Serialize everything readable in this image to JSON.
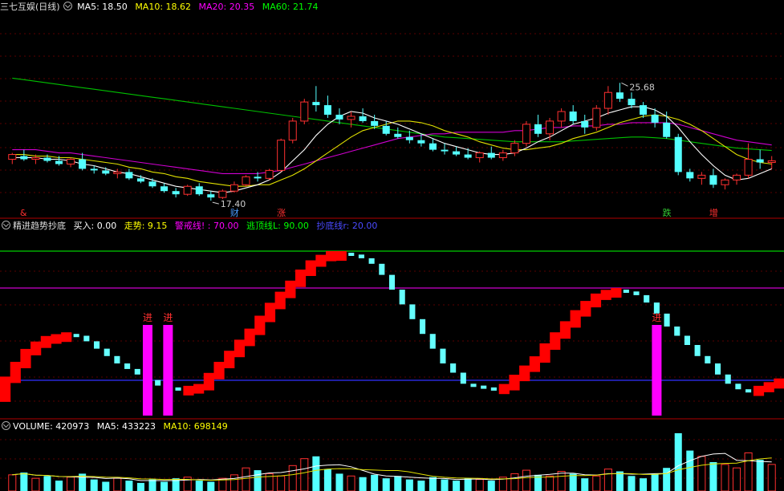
{
  "main": {
    "title": "三七互娱(日线)",
    "ma": [
      {
        "label": "MA5: 18.50",
        "color": "#ffffff"
      },
      {
        "label": "MA10: 18.62",
        "color": "#ffff00"
      },
      {
        "label": "MA20: 20.35",
        "color": "#ff00ff"
      },
      {
        "label": "MA60: 21.74",
        "color": "#00ff00"
      }
    ],
    "high_label": "25.68",
    "low_label": "17.40",
    "event_markers": [
      {
        "text": "&",
        "color": "#ff3030",
        "date_index": 1
      },
      {
        "text": "财",
        "color": "#4a9cff",
        "date_index": 19
      },
      {
        "text": "涨",
        "color": "#ff3030",
        "date_index": 23
      },
      {
        "text": "跌",
        "color": "#33cc33",
        "date_index": 56
      },
      {
        "text": "增",
        "color": "#ff3030",
        "date_index": 60
      }
    ],
    "candles": [
      [
        17.2,
        17.6,
        16.9,
        17.5
      ],
      [
        17.4,
        17.8,
        17.1,
        17.2
      ],
      [
        17.2,
        17.5,
        16.9,
        17.3
      ],
      [
        17.3,
        17.5,
        17.0,
        17.1
      ],
      [
        17.1,
        17.4,
        16.8,
        16.9
      ],
      [
        16.9,
        17.3,
        16.7,
        17.2
      ],
      [
        17.2,
        17.6,
        16.5,
        16.6
      ],
      [
        16.6,
        16.8,
        16.3,
        16.5
      ],
      [
        16.5,
        16.7,
        16.2,
        16.3
      ],
      [
        16.3,
        16.6,
        16.0,
        16.4
      ],
      [
        16.4,
        16.6,
        15.9,
        16.0
      ],
      [
        16.0,
        16.2,
        15.7,
        15.8
      ],
      [
        15.8,
        16.0,
        15.4,
        15.5
      ],
      [
        15.5,
        15.7,
        15.1,
        15.2
      ],
      [
        15.2,
        15.4,
        14.8,
        15.0
      ],
      [
        15.0,
        15.6,
        14.9,
        15.5
      ],
      [
        15.5,
        15.7,
        14.9,
        15.0
      ],
      [
        15.0,
        15.2,
        14.6,
        14.8
      ],
      [
        14.8,
        15.3,
        14.7,
        15.2
      ],
      [
        15.2,
        15.8,
        15.1,
        15.6
      ],
      [
        15.6,
        16.2,
        15.5,
        16.1
      ],
      [
        16.1,
        16.4,
        15.8,
        16.0
      ],
      [
        16.0,
        16.6,
        15.9,
        16.5
      ],
      [
        16.5,
        18.5,
        16.4,
        18.4
      ],
      [
        18.4,
        19.8,
        18.2,
        19.6
      ],
      [
        19.6,
        21.0,
        19.4,
        20.8
      ],
      [
        20.8,
        21.8,
        20.2,
        20.6
      ],
      [
        20.6,
        21.2,
        19.8,
        20.0
      ],
      [
        20.0,
        20.4,
        19.4,
        19.7
      ],
      [
        19.7,
        20.2,
        19.2,
        19.9
      ],
      [
        19.9,
        20.4,
        19.5,
        19.6
      ],
      [
        19.6,
        20.0,
        19.1,
        19.3
      ],
      [
        19.3,
        19.6,
        18.7,
        18.8
      ],
      [
        18.8,
        19.2,
        18.5,
        18.6
      ],
      [
        18.6,
        19.0,
        18.2,
        18.4
      ],
      [
        18.4,
        18.8,
        18.0,
        18.2
      ],
      [
        18.2,
        18.5,
        17.7,
        17.8
      ],
      [
        17.8,
        18.2,
        17.5,
        17.7
      ],
      [
        17.7,
        18.0,
        17.4,
        17.5
      ],
      [
        17.5,
        17.9,
        17.2,
        17.3
      ],
      [
        17.3,
        17.7,
        17.0,
        17.6
      ],
      [
        17.6,
        18.0,
        17.2,
        17.3
      ],
      [
        17.3,
        17.8,
        17.1,
        17.6
      ],
      [
        17.6,
        18.4,
        17.4,
        18.2
      ],
      [
        18.2,
        19.6,
        18.0,
        19.4
      ],
      [
        19.4,
        20.0,
        18.6,
        18.8
      ],
      [
        18.8,
        19.8,
        18.4,
        19.6
      ],
      [
        19.6,
        20.4,
        19.2,
        20.2
      ],
      [
        20.2,
        20.6,
        19.4,
        19.6
      ],
      [
        19.6,
        20.0,
        18.8,
        19.2
      ],
      [
        19.2,
        20.6,
        19.0,
        20.4
      ],
      [
        20.4,
        21.8,
        20.0,
        21.4
      ],
      [
        21.4,
        22.0,
        20.8,
        21.0
      ],
      [
        21.0,
        21.4,
        20.4,
        20.6
      ],
      [
        20.6,
        20.8,
        19.8,
        20.0
      ],
      [
        20.0,
        20.4,
        19.2,
        19.5
      ],
      [
        19.5,
        20.2,
        18.5,
        18.6
      ],
      [
        18.6,
        18.8,
        16.2,
        16.4
      ],
      [
        16.4,
        16.6,
        15.8,
        16.0
      ],
      [
        16.0,
        16.4,
        15.6,
        16.2
      ],
      [
        16.2,
        16.6,
        15.4,
        15.6
      ],
      [
        15.6,
        16.0,
        15.3,
        15.9
      ],
      [
        15.9,
        16.3,
        15.6,
        16.2
      ],
      [
        16.2,
        18.2,
        16.0,
        17.2
      ],
      [
        17.2,
        17.8,
        16.6,
        17.0
      ],
      [
        17.0,
        17.4,
        16.6,
        17.1
      ]
    ],
    "ma5": [
      17.3,
      17.3,
      17.3,
      17.2,
      17.2,
      17.1,
      16.9,
      16.8,
      16.6,
      16.4,
      16.3,
      16.1,
      15.9,
      15.7,
      15.5,
      15.4,
      15.3,
      15.2,
      15.1,
      15.2,
      15.4,
      15.6,
      15.9,
      16.4,
      17.1,
      17.8,
      18.7,
      19.4,
      19.9,
      20.2,
      20.1,
      19.8,
      19.6,
      19.4,
      19.1,
      18.8,
      18.5,
      18.2,
      18.0,
      17.8,
      17.6,
      17.5,
      17.5,
      17.6,
      17.9,
      18.3,
      18.6,
      19.0,
      19.4,
      19.6,
      19.8,
      20.1,
      20.3,
      20.5,
      20.5,
      20.3,
      19.9,
      19.2,
      18.3,
      17.5,
      16.8,
      16.2,
      15.9,
      16.0,
      16.3,
      16.6
    ],
    "ma10": [
      17.5,
      17.5,
      17.4,
      17.4,
      17.3,
      17.3,
      17.2,
      17.1,
      17.0,
      16.9,
      16.7,
      16.6,
      16.4,
      16.3,
      16.1,
      16.0,
      15.8,
      15.7,
      15.6,
      15.5,
      15.5,
      15.6,
      15.6,
      15.9,
      16.2,
      16.6,
      17.1,
      17.6,
      18.1,
      18.6,
      19.0,
      19.2,
      19.4,
      19.6,
      19.6,
      19.5,
      19.3,
      19.0,
      18.8,
      18.6,
      18.3,
      18.1,
      17.9,
      17.8,
      17.8,
      17.9,
      18.0,
      18.2,
      18.5,
      18.7,
      18.9,
      19.2,
      19.5,
      19.7,
      19.9,
      20.0,
      19.9,
      19.7,
      19.4,
      19.0,
      18.5,
      18.0,
      17.5,
      17.2,
      17.0,
      16.9
    ],
    "ma20": [
      17.8,
      17.8,
      17.8,
      17.7,
      17.6,
      17.6,
      17.5,
      17.4,
      17.3,
      17.2,
      17.1,
      17.0,
      16.9,
      16.8,
      16.7,
      16.6,
      16.5,
      16.4,
      16.3,
      16.3,
      16.3,
      16.3,
      16.4,
      16.5,
      16.7,
      16.9,
      17.1,
      17.3,
      17.5,
      17.7,
      17.9,
      18.1,
      18.3,
      18.5,
      18.6,
      18.7,
      18.8,
      18.8,
      18.9,
      18.9,
      18.9,
      18.9,
      18.9,
      19.0,
      19.0,
      19.1,
      19.2,
      19.2,
      19.3,
      19.3,
      19.3,
      19.4,
      19.4,
      19.5,
      19.5,
      19.5,
      19.5,
      19.4,
      19.2,
      19.0,
      18.8,
      18.6,
      18.4,
      18.3,
      18.2,
      18.1
    ],
    "ma60": [
      22.3,
      22.2,
      22.1,
      22.0,
      21.9,
      21.8,
      21.7,
      21.6,
      21.5,
      21.4,
      21.3,
      21.2,
      21.1,
      21.0,
      20.9,
      20.8,
      20.7,
      20.6,
      20.5,
      20.4,
      20.3,
      20.2,
      20.1,
      20.0,
      19.9,
      19.8,
      19.7,
      19.6,
      19.5,
      19.4,
      19.3,
      19.2,
      19.1,
      19.0,
      18.9,
      18.8,
      18.7,
      18.6,
      18.55,
      18.5,
      18.45,
      18.4,
      18.35,
      18.3,
      18.3,
      18.3,
      18.3,
      18.3,
      18.35,
      18.4,
      18.45,
      18.5,
      18.55,
      18.6,
      18.6,
      18.55,
      18.5,
      18.4,
      18.3,
      18.2,
      18.1,
      18.0,
      17.9,
      17.85,
      17.8,
      17.75
    ],
    "price_range": [
      14.0,
      26.2
    ]
  },
  "indicator": {
    "name": "精进趋势抄底",
    "buy": "买入: 0.00",
    "trend": "走势: 9.15",
    "warning": "警戒线! : 70.00",
    "escape": "逃顶线L: 90.00",
    "bottom": "抄底线r: 20.00",
    "colors": {
      "buy": "#ffffff",
      "trend": "#ffff00",
      "warning": "#ff00ff",
      "escape": "#00ff00",
      "bottom": "#4040ff",
      "up": "#ff0000",
      "down": "#66ffff",
      "buyBar": "#ff00ff"
    },
    "range": [
      0,
      100
    ],
    "levels": [
      {
        "v": 90,
        "color": "#00cc00"
      },
      {
        "v": 70,
        "color": "#cc00cc"
      },
      {
        "v": 20,
        "color": "#3030ff"
      }
    ],
    "trend_values": [
      22,
      30,
      37,
      41,
      44,
      45,
      46,
      45,
      42,
      38,
      34,
      30,
      27,
      24,
      21,
      18,
      17,
      16,
      17,
      18,
      24,
      30,
      36,
      42,
      48,
      55,
      62,
      68,
      74,
      80,
      85,
      88,
      90,
      90,
      89,
      87,
      84,
      78,
      70,
      62,
      54,
      46,
      38,
      30,
      25,
      19,
      18,
      17,
      16,
      18,
      23,
      28,
      33,
      40,
      46,
      52,
      58,
      63,
      67,
      69,
      70,
      69,
      67,
      63,
      57,
      50,
      45,
      40,
      34,
      30,
      24,
      19,
      16,
      15,
      17,
      19,
      21
    ],
    "buy_signals": [
      {
        "index": 14,
        "label": "进"
      },
      {
        "index": 16,
        "label": "进"
      },
      {
        "index": 64,
        "label": "进"
      }
    ]
  },
  "volume": {
    "label": "VOLUME: 420973",
    "ma5": "MA5: 433223",
    "ma10": "MA10: 698149",
    "colors": {
      "label": "#ffffff",
      "ma5": "#ffffff",
      "ma10": "#ffff00"
    },
    "bars": [
      28,
      32,
      22,
      26,
      18,
      24,
      30,
      20,
      16,
      22,
      18,
      14,
      20,
      16,
      22,
      24,
      18,
      16,
      22,
      28,
      40,
      36,
      30,
      26,
      44,
      56,
      60,
      38,
      30,
      26,
      24,
      28,
      22,
      26,
      20,
      18,
      24,
      20,
      18,
      22,
      20,
      18,
      24,
      30,
      36,
      28,
      26,
      34,
      30,
      22,
      26,
      38,
      34,
      26,
      22,
      30,
      40,
      100,
      70,
      60,
      50,
      46,
      40,
      66,
      54,
      46
    ],
    "max": 100
  }
}
